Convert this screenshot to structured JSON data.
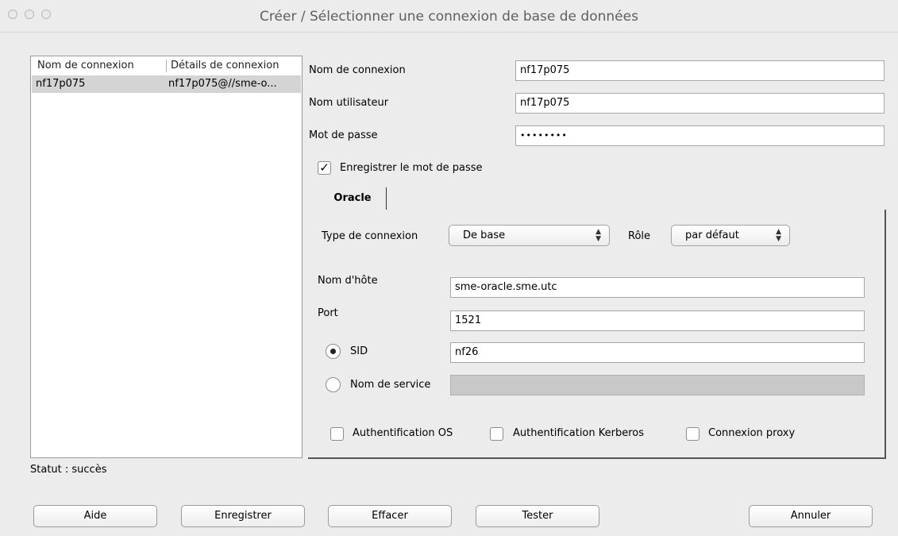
{
  "window": {
    "title": "Créer / Sélectionner une connexion de base de données"
  },
  "connection_list": {
    "columns": [
      "Nom de connexion",
      "Détails de connexion"
    ],
    "rows": [
      {
        "name": "nf17p075",
        "details": "nf17p075@//sme-o..."
      }
    ]
  },
  "form": {
    "connection_name": {
      "label": "Nom de connexion",
      "value": "nf17p075"
    },
    "username": {
      "label": "Nom utilisateur",
      "value": "nf17p075"
    },
    "password": {
      "label": "Mot de passe",
      "value": "••••••••"
    },
    "save_password": {
      "label": "Enregistrer le mot de passe",
      "checked": true
    }
  },
  "tabs": [
    {
      "label": "Oracle",
      "active": true
    }
  ],
  "oracle": {
    "connection_type": {
      "label": "Type de connexion",
      "value": "De base"
    },
    "role": {
      "label": "Rôle",
      "value": "par défaut"
    },
    "hostname": {
      "label": "Nom d'hôte",
      "value": "sme-oracle.sme.utc"
    },
    "port": {
      "label": "Port",
      "value": "1521"
    },
    "sid": {
      "label": "SID",
      "value": "nf26",
      "selected": true
    },
    "service_name": {
      "label": "Nom de service",
      "value": "",
      "selected": false
    },
    "os_auth": {
      "label": "Authentification OS",
      "checked": false
    },
    "kerberos_auth": {
      "label": "Authentification Kerberos",
      "checked": false
    },
    "proxy": {
      "label": "Connexion proxy",
      "checked": false
    }
  },
  "status": {
    "text": "Statut : succès"
  },
  "buttons": {
    "help": "Aide",
    "save": "Enregistrer",
    "clear": "Effacer",
    "test": "Tester",
    "cancel": "Annuler"
  },
  "icons": {
    "check": "✓",
    "updown": "updown-arrows-icon"
  }
}
